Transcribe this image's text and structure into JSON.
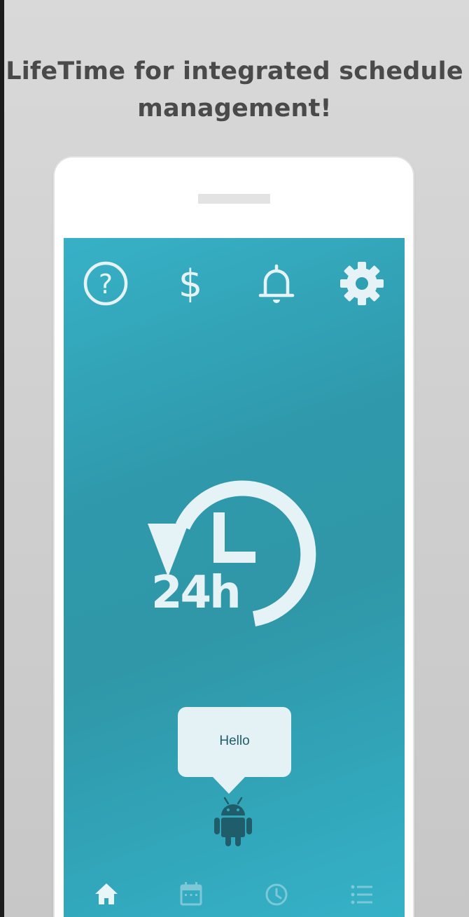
{
  "headline": "LifeTime for integrated schedule management!",
  "top_icons": [
    {
      "name": "help-icon",
      "label": "?"
    },
    {
      "name": "dollar-icon",
      "label": "$"
    },
    {
      "name": "bell-icon"
    },
    {
      "name": "gear-icon"
    }
  ],
  "hero": {
    "label": "24h",
    "icon": "clock-24h-icon"
  },
  "assistant": {
    "message": "Hello",
    "icon": "android-icon"
  },
  "bottom_nav": [
    {
      "name": "nav-home",
      "icon": "home-icon",
      "active": true
    },
    {
      "name": "nav-calendar",
      "icon": "calendar-icon",
      "active": false
    },
    {
      "name": "nav-clock",
      "icon": "clock-icon",
      "active": false
    },
    {
      "name": "nav-list",
      "icon": "list-icon",
      "active": false
    }
  ],
  "colors": {
    "screen": "#2f9eb1",
    "icon_light": "#e6f3f6",
    "icon_dim": "#7cc8d6",
    "bubble": "#e4f1f5",
    "robot": "#1f5d6b",
    "headline": "#4a4a4a"
  }
}
